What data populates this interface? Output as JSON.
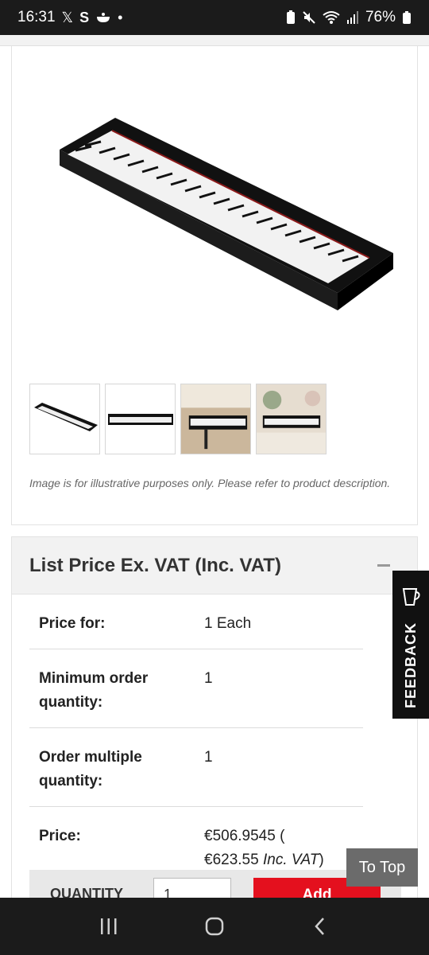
{
  "status_bar": {
    "time": "16:31",
    "left_icons": [
      "x-icon",
      "s-icon",
      "cooking-icon",
      "dot-icon"
    ],
    "battery_percent": "76%"
  },
  "product_images": {
    "thumbnails": [
      "keyboard-angle",
      "keyboard-front",
      "keyboard-room",
      "keyboard-desk"
    ],
    "disclaimer": "Image is for illustrative purposes only. Please refer to product description."
  },
  "price_section": {
    "title": "List Price Ex. VAT (Inc. VAT)",
    "rows": [
      {
        "label": "Price for:",
        "value": "1 Each"
      },
      {
        "label": "Minimum order quantity:",
        "value": "1"
      },
      {
        "label": "Order multiple quantity:",
        "value": "1"
      },
      {
        "label": "Price:",
        "value_main": "€506.9545 (",
        "value_inc": "€623.55 ",
        "value_inc_italic": "Inc. VAT",
        "value_close": ")"
      }
    ],
    "quantity_label": "QUANTITY",
    "quantity_value": "1",
    "add_label": "Add"
  },
  "feedback_label": "FEEDBACK",
  "to_top_label": "To Top",
  "colors": {
    "accent_red": "#e4101e",
    "status_bar_bg": "#1b1b1b",
    "feedback_bg": "#111111"
  }
}
